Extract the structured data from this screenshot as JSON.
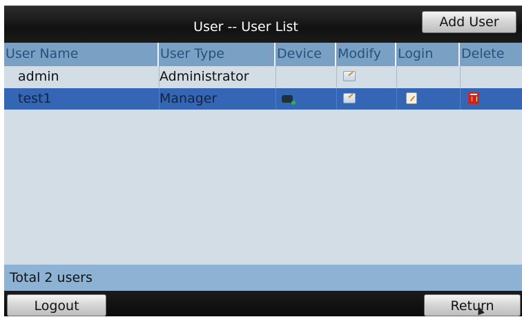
{
  "header": {
    "title": "User -- User List",
    "add_user_label": "Add User"
  },
  "table": {
    "columns": [
      "User Name",
      "User Type",
      "Device",
      "Modify",
      "Login",
      "Delete"
    ],
    "rows": [
      {
        "name": "admin",
        "type": "Administrator",
        "icons": [
          "edit-icon"
        ],
        "selected": false
      },
      {
        "name": "test1",
        "type": "Manager",
        "icons": [
          "device-icon",
          "edit-icon",
          "login-permission-icon",
          "delete-icon"
        ],
        "selected": true
      }
    ]
  },
  "footer": {
    "total_text": "Total 2 users"
  },
  "bottom": {
    "logout_label": "Logout",
    "return_label": "Return"
  },
  "colors": {
    "title_bar": "#111111",
    "header_row": "#7aa1c4",
    "header_text": "#24527e",
    "selected_row": "#3566b6",
    "list_background": "#d3dde6",
    "footer": "#8db2d3",
    "delete_icon": "#c9261c"
  }
}
